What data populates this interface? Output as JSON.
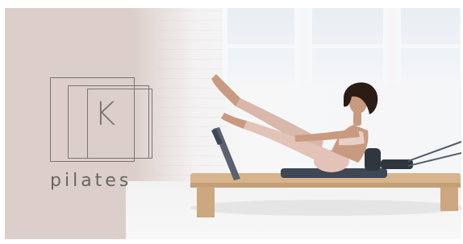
{
  "brand": {
    "logo_letter": "K",
    "logo_text": "pilates"
  },
  "colors": {
    "panel": "#dccfcb",
    "logo_stroke": "#7a7472",
    "reformer_wood": "#d7b48c",
    "reformer_pad": "#3e4754",
    "skin": "#c89a7f",
    "outfit": "#e3c3b7",
    "hair": "#2b1d16"
  },
  "icons": {
    "logo": "square-frames-logo-icon",
    "reformer": "pilates-reformer-icon",
    "instructor": "instructor-photo-icon"
  }
}
